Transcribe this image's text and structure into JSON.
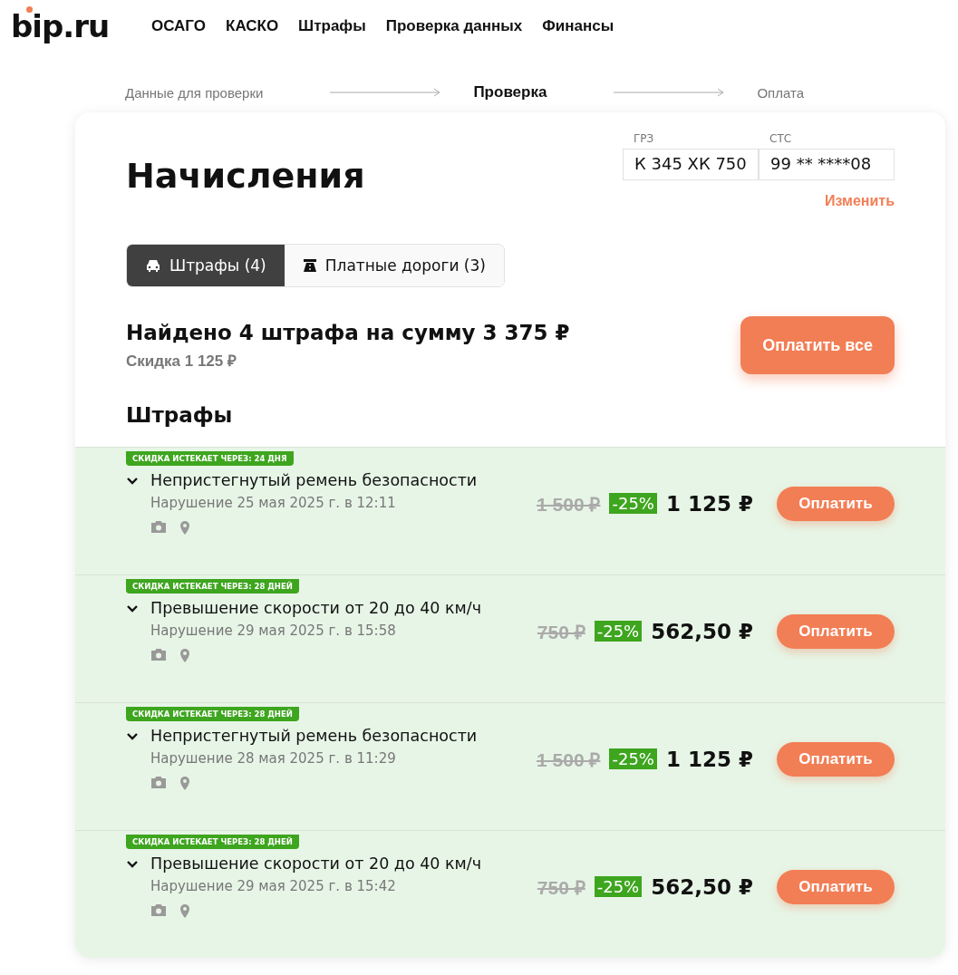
{
  "logo": "bip.ru",
  "nav": [
    "ОСАГО",
    "КАСКО",
    "Штрафы",
    "Проверка данных",
    "Финансы"
  ],
  "steps": [
    {
      "label": "Данные для проверки",
      "selected": false
    },
    {
      "label": "Проверка",
      "selected": true
    },
    {
      "label": "Оплата",
      "selected": false
    }
  ],
  "title": "Начисления",
  "vehicle": {
    "plate_label": "ГРЗ",
    "plate": "К 345 ХК 750",
    "sts_label": "СТС",
    "sts": "99 ** ****08",
    "change": "Изменить"
  },
  "tabs": [
    {
      "label": "Штрафы (4)",
      "kind": "car",
      "selected": true
    },
    {
      "label": "Платные дороги (3)",
      "kind": "road",
      "selected": false
    }
  ],
  "summary": {
    "title": "Найдено 4 штрафа на сумму 3 375 ₽",
    "discount": "Скидка 1 125 ₽",
    "pay_all": "Оплатить все"
  },
  "section_title": "Штрафы",
  "fines": [
    {
      "badge": "СКИДКА ИСТЕКАЕТ ЧЕРЕЗ: 24 ДНЯ",
      "title": "Непристегнутый ремень безопасности",
      "date": "Нарушение 25 мая 2025 г. в 12:11",
      "old_price": "1 500 ₽",
      "discount": "-25%",
      "price": "1 125 ₽",
      "button": "Оплатить"
    },
    {
      "badge": "СКИДКА ИСТЕКАЕТ ЧЕРЕЗ: 28 ДНЕЙ",
      "title": "Превышение скорости от 20 до 40 км/ч",
      "date": "Нарушение 29 мая 2025 г. в 15:58",
      "old_price": "750 ₽",
      "discount": "-25%",
      "price": "562,50 ₽",
      "button": "Оплатить"
    },
    {
      "badge": "СКИДКА ИСТЕКАЕТ ЧЕРЕЗ: 28 ДНЕЙ",
      "title": "Непристегнутый ремень безопасности",
      "date": "Нарушение 28 мая 2025 г. в 11:29",
      "old_price": "1 500 ₽",
      "discount": "-25%",
      "price": "1 125 ₽",
      "button": "Оплатить"
    },
    {
      "badge": "СКИДКА ИСТЕКАЕТ ЧЕРЕЗ: 28 ДНЕЙ",
      "title": "Превышение скорости от 20 до 40 км/ч",
      "date": "Нарушение 29 мая 2025 г. в 15:42",
      "old_price": "750 ₽",
      "discount": "-25%",
      "price": "562,50 ₽",
      "button": "Оплатить"
    }
  ]
}
